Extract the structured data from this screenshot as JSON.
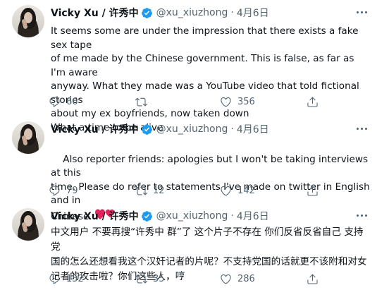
{
  "tweets": [
    {
      "name": "Vicky Xu / 许秀中",
      "handle": "@xu_xiuzhong",
      "date": "4月6日",
      "text": "It seems some are under the impression that there exists a fake sex tape\nof me made by the Chinese government. This is false, as far as I'm aware\nanyway. What they made was a YouTube video that told fictional stories\nabout my ex boyfriends, now taken down\nWhat a time to be alive",
      "replies": "66",
      "retweets": "",
      "likes": "356"
    },
    {
      "name": "Vicky Xu / 许秀中",
      "handle": "@xu_xiuzhong",
      "date": "4月6日",
      "text": "Also reporter friends: apologies but I won't be taking interviews at this\ntime. Please do refer to statements I've made on twitter in English and in\nChinese. ",
      "emoji": "two-hearts",
      "replies": "79",
      "retweets": "12",
      "likes": "142"
    },
    {
      "name": "Vicky Xu / 许秀中",
      "handle": "@xu_xiuzhong",
      "date": "4月6日",
      "text": "中文用户 不要再搜“许秀中 群”了 这个片子不存在 你们反省反省自己 支持党\n国的怎么还想看我这个汉奸记者的片呢？不支持党国的话就更不该附和对女\n记者的攻击啦？你们这些人，哼",
      "replies": "152",
      "retweets": "35",
      "likes": "286"
    }
  ],
  "colors": {
    "verified": "#1d9bf0",
    "muted": "#536471",
    "text": "#0f1419",
    "heart": "#e0245e"
  },
  "icons": {
    "reply": "reply-icon",
    "retweet": "retweet-icon",
    "like": "like-icon",
    "share": "share-icon",
    "verified": "verified-badge-icon",
    "more": "more-icon"
  }
}
